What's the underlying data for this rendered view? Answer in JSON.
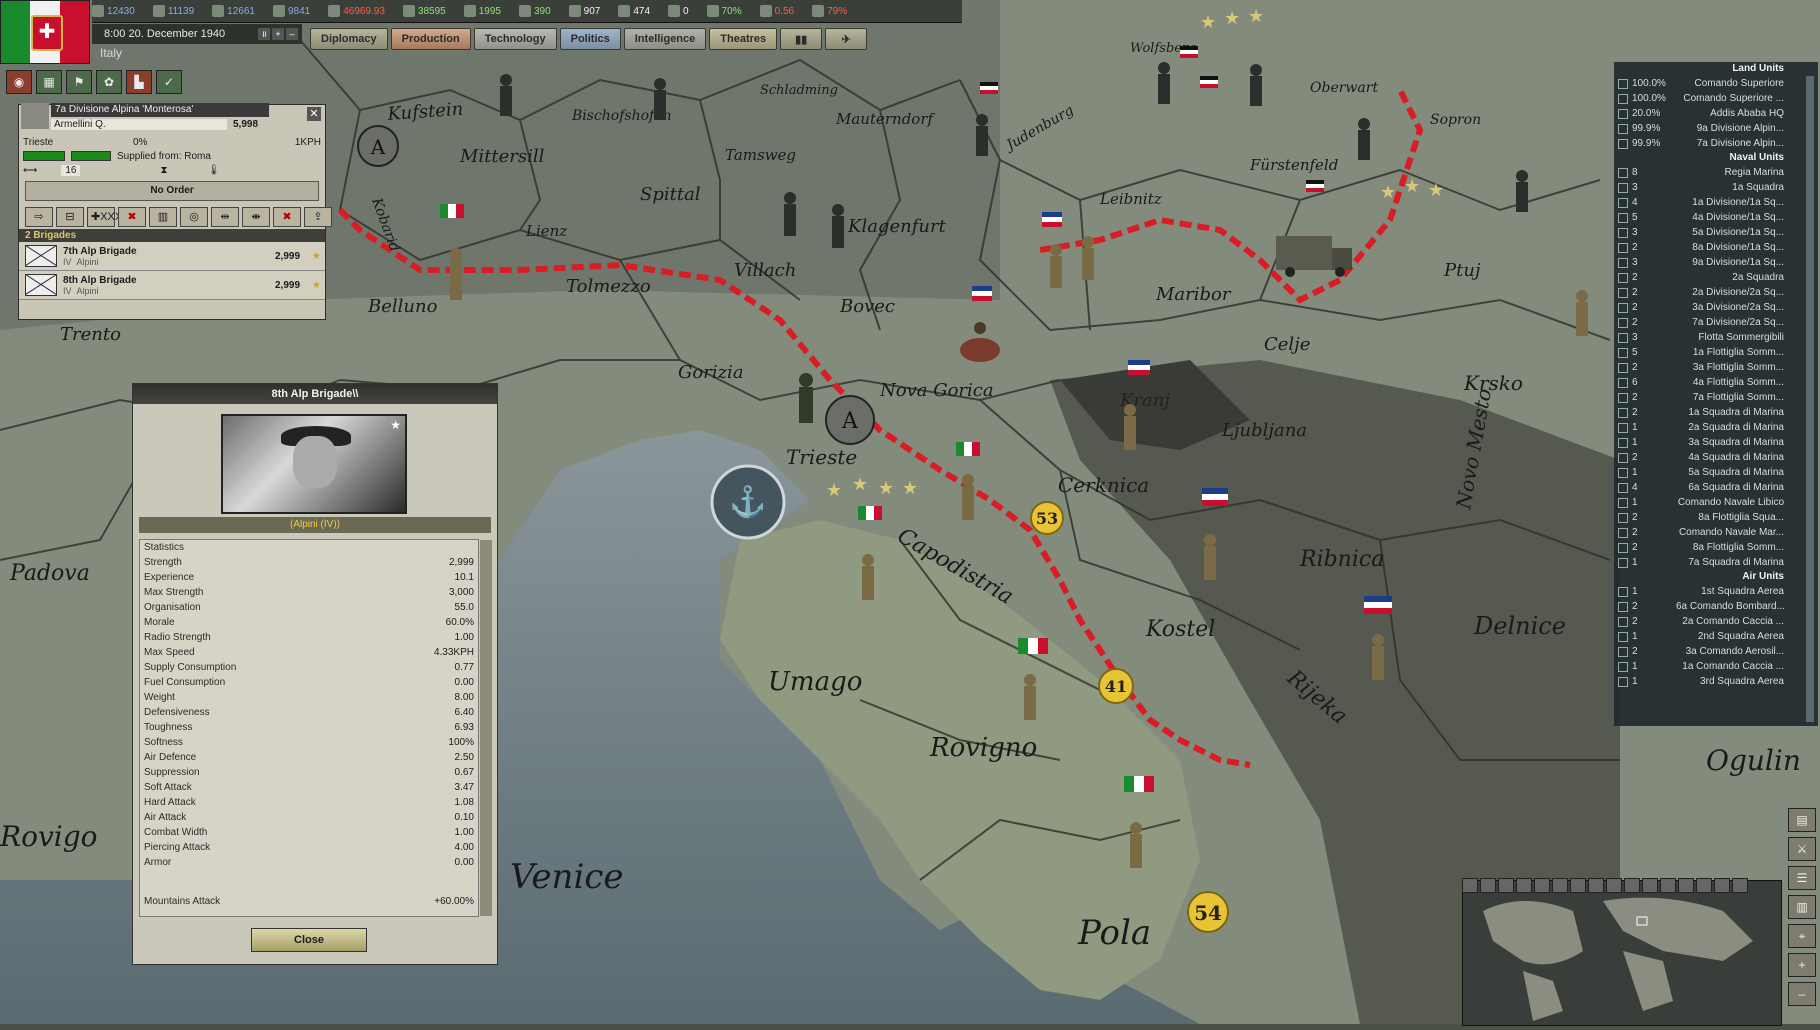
{
  "topbar": {
    "resources": [
      {
        "icon": "energy-icon",
        "value": "12430",
        "tone": "blue"
      },
      {
        "icon": "metal-icon",
        "value": "11139",
        "tone": "blue"
      },
      {
        "icon": "rare-materials-icon",
        "value": "12661",
        "tone": "blue"
      },
      {
        "icon": "oil-icon",
        "value": "9841",
        "tone": "blue"
      },
      {
        "icon": "supplies-icon",
        "value": "46969.93",
        "tone": "red"
      },
      {
        "icon": "money-icon",
        "value": "38595",
        "tone": "green"
      },
      {
        "icon": "fuel-icon",
        "value": "1995",
        "tone": "green"
      },
      {
        "icon": "cash-icon",
        "value": "390",
        "tone": "green"
      },
      {
        "icon": "manpower-icon",
        "value": "907",
        "tone": "white"
      },
      {
        "icon": "diplomacy-icon",
        "value": "474",
        "tone": "white"
      },
      {
        "icon": "spies-icon",
        "value": "0",
        "tone": "white"
      },
      {
        "icon": "dissent-icon",
        "value": "70%",
        "tone": "green"
      },
      {
        "icon": "unity-icon",
        "value": "0.56",
        "tone": "red"
      },
      {
        "icon": "support-icon",
        "value": "79%",
        "tone": "red"
      }
    ],
    "date": "8:00 20. December 1940",
    "country": "Italy",
    "tabs": [
      "Diplomacy",
      "Production",
      "Technology",
      "Politics",
      "Intelligence",
      "Theatres"
    ]
  },
  "unit_panel": {
    "name": "7a Divisione Alpina 'Monterosa'",
    "leader": "Armellini Q.",
    "strength": "5,998",
    "location": "Trieste",
    "percent": "0%",
    "speed": "1KPH",
    "supplied_from": "Supplied from: Roma",
    "days": "16",
    "order": "No Order",
    "brigades_header": "2 Brigades",
    "brigades": [
      {
        "name": "7th Alp Brigade",
        "level": "IV",
        "type": "Alpini",
        "strength": "2,999"
      },
      {
        "name": "8th Alp Brigade",
        "level": "IV",
        "type": "Alpini",
        "strength": "2,999"
      }
    ]
  },
  "brigade_details": {
    "title": "8th Alp Brigade\\\\",
    "type": "(Alpini (IV))",
    "stats_header": "Statistics",
    "stats": [
      {
        "label": "Strength",
        "value": "2,999"
      },
      {
        "label": "Experience",
        "value": "10.1"
      },
      {
        "label": "Max Strength",
        "value": "3,000"
      },
      {
        "label": "Organisation",
        "value": "55.0"
      },
      {
        "label": "Morale",
        "value": "60.0%"
      },
      {
        "label": "Radio Strength",
        "value": "1.00"
      },
      {
        "label": "Max Speed",
        "value": "4.33KPH"
      },
      {
        "label": "Supply Consumption",
        "value": "0.77"
      },
      {
        "label": "Fuel Consumption",
        "value": "0.00"
      },
      {
        "label": "Weight",
        "value": "8.00"
      },
      {
        "label": "Defensiveness",
        "value": "6.40"
      },
      {
        "label": "Toughness",
        "value": "6.93"
      },
      {
        "label": "Softness",
        "value": "100%"
      },
      {
        "label": "Air Defence",
        "value": "2.50"
      },
      {
        "label": "Suppression",
        "value": "0.67"
      },
      {
        "label": "Soft Attack",
        "value": "3.47"
      },
      {
        "label": "Hard Attack",
        "value": "1.08"
      },
      {
        "label": "Air Attack",
        "value": "0.10"
      },
      {
        "label": "Combat Width",
        "value": "1.00"
      },
      {
        "label": "Piercing Attack",
        "value": "4.00"
      },
      {
        "label": "Armor",
        "value": "0.00"
      }
    ],
    "bonus": {
      "label": "Mountains Attack",
      "value": "+60.00%"
    },
    "close_label": "Close"
  },
  "unit_list": {
    "land_header": "Land Units",
    "land": [
      {
        "c": "100.0%",
        "n": "Comando Superiore"
      },
      {
        "c": "100.0%",
        "n": "Comando Superiore ..."
      },
      {
        "c": "20.0%",
        "n": "Addis Ababa HQ"
      },
      {
        "c": "99.9%",
        "n": "9a Divisione Alpin..."
      },
      {
        "c": "99.9%",
        "n": "7a Divisione Alpin..."
      }
    ],
    "naval_header": "Naval Units",
    "naval": [
      {
        "c": "8",
        "n": "Regia Marina"
      },
      {
        "c": "3",
        "n": "1a Squadra"
      },
      {
        "c": "4",
        "n": "1a Divisione/1a Sq..."
      },
      {
        "c": "5",
        "n": "4a Divisione/1a Sq..."
      },
      {
        "c": "3",
        "n": "5a Divisione/1a Sq..."
      },
      {
        "c": "2",
        "n": "8a Divisione/1a Sq..."
      },
      {
        "c": "3",
        "n": "9a Divisione/1a Sq..."
      },
      {
        "c": "2",
        "n": "2a Squadra"
      },
      {
        "c": "2",
        "n": "2a Divisione/2a Sq..."
      },
      {
        "c": "2",
        "n": "3a Divisione/2a Sq..."
      },
      {
        "c": "2",
        "n": "7a Divisione/2a Sq..."
      },
      {
        "c": "3",
        "n": "Flotta Sommergibili"
      },
      {
        "c": "5",
        "n": "1a Flottiglia Somm..."
      },
      {
        "c": "2",
        "n": "3a Flottiglia Somm..."
      },
      {
        "c": "6",
        "n": "4a Flottiglia Somm..."
      },
      {
        "c": "2",
        "n": "7a Flottiglia Somm..."
      },
      {
        "c": "2",
        "n": "1a Squadra di Marina"
      },
      {
        "c": "1",
        "n": "2a Squadra di Marina"
      },
      {
        "c": "1",
        "n": "3a Squadra di Marina"
      },
      {
        "c": "2",
        "n": "4a Squadra di Marina"
      },
      {
        "c": "1",
        "n": "5a Squadra di Marina"
      },
      {
        "c": "4",
        "n": "6a Squadra di Marina"
      },
      {
        "c": "1",
        "n": "Comando Navale Libico"
      },
      {
        "c": "2",
        "n": "8a Flottiglia Squa..."
      },
      {
        "c": "2",
        "n": "Comando Navale Mar..."
      },
      {
        "c": "2",
        "n": "8a Flottiglia Somm..."
      },
      {
        "c": "1",
        "n": "7a Squadra di Marina"
      }
    ],
    "air_header": "Air Units",
    "air": [
      {
        "c": "1",
        "n": "1st Squadra Aerea"
      },
      {
        "c": "2",
        "n": "6a Comando Bombard..."
      },
      {
        "c": "2",
        "n": "2a Comando Caccia ..."
      },
      {
        "c": "1",
        "n": "2nd Squadra Aerea"
      },
      {
        "c": "2",
        "n": "3a Comando Aerosil..."
      },
      {
        "c": "1",
        "n": "1a Comando Caccia ..."
      },
      {
        "c": "1",
        "n": "3rd Squadra Aerea"
      }
    ]
  },
  "map": {
    "places": [
      {
        "name": "Kufstein"
      },
      {
        "name": "Bischofshofen"
      },
      {
        "name": "Mittersill"
      },
      {
        "name": "Tamsweg"
      },
      {
        "name": "Spittal"
      },
      {
        "name": "Lienz"
      },
      {
        "name": "Klagenfurt"
      },
      {
        "name": "Villach"
      },
      {
        "name": "Tolmezzo"
      },
      {
        "name": "Belluno"
      },
      {
        "name": "Trento"
      },
      {
        "name": "Bovec"
      },
      {
        "name": "Gorizia"
      },
      {
        "name": "Nova Gorica"
      },
      {
        "name": "Trieste"
      },
      {
        "name": "Kranj"
      },
      {
        "name": "Ljubljana"
      },
      {
        "name": "Cerknica"
      },
      {
        "name": "Capodistria"
      },
      {
        "name": "Kostel"
      },
      {
        "name": "Ribnica"
      },
      {
        "name": "Umago"
      },
      {
        "name": "Rovigno"
      },
      {
        "name": "Rijeka"
      },
      {
        "name": "Pola"
      },
      {
        "name": "Venice"
      },
      {
        "name": "Padova"
      },
      {
        "name": "Celje"
      },
      {
        "name": "Krsko"
      },
      {
        "name": "Ptuj"
      },
      {
        "name": "Maribor"
      },
      {
        "name": "Leibnitz"
      },
      {
        "name": "Fürstenfeld"
      },
      {
        "name": "Sopron"
      },
      {
        "name": "Oberwart"
      },
      {
        "name": "Judenburg"
      },
      {
        "name": "Novo Mesto"
      },
      {
        "name": "Delnice"
      },
      {
        "name": "Ogulin"
      },
      {
        "name": "Rovigo"
      },
      {
        "name": "Schladming"
      },
      {
        "name": "Mauterndorf"
      },
      {
        "name": "Wolfsberg"
      },
      {
        "name": "Kobarid"
      }
    ],
    "badges": [
      "53",
      "41",
      "54"
    ],
    "colors": {
      "front_line": "#d81e24",
      "sea": "#6e8088",
      "land": "#7d8774"
    }
  }
}
